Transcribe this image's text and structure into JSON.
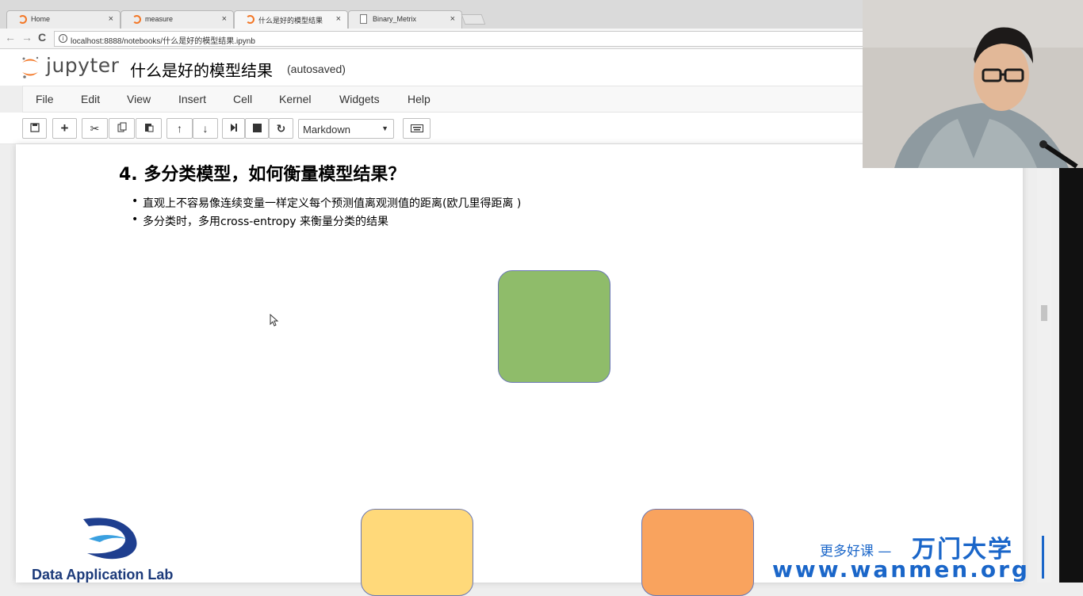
{
  "browser": {
    "tabs": [
      {
        "label": "Home",
        "icon": "jupyter-icon"
      },
      {
        "label": "measure",
        "icon": "jupyter-icon"
      },
      {
        "label": "什么是好的模型结果",
        "icon": "jupyter-icon",
        "active": true
      },
      {
        "label": "Binary_Metrix",
        "icon": "file-icon"
      }
    ],
    "close_glyph": "×",
    "url": "localhost:8888/notebooks/什么是好的模型结果.ipynb",
    "back_glyph": "←",
    "forward_glyph": "→",
    "reload_glyph": "C"
  },
  "jupyter": {
    "logo_text": "jupyter",
    "notebook_title": "什么是好的模型结果",
    "save_status": "(autosaved)",
    "menu": [
      "File",
      "Edit",
      "View",
      "Insert",
      "Cell",
      "Kernel",
      "Widgets",
      "Help"
    ],
    "toolbar": {
      "icons": [
        "save-icon",
        "add-cell-icon",
        "cut-icon",
        "copy-icon",
        "paste-icon",
        "move-up-icon",
        "move-down-icon",
        "run-icon",
        "stop-icon",
        "restart-icon",
        "keyboard-icon"
      ],
      "cell_type": "Markdown"
    }
  },
  "cell": {
    "heading": "4. 多分类模型，如何衡量模型结果？",
    "bullets": [
      "直观上不容易像连续变量一样定义每个预测值离观测值的距离(欧几里得距离 )",
      "多分类时，多用cross-entropy 来衡量分类的结果"
    ],
    "boxes": [
      {
        "color": "#8fbc6a"
      },
      {
        "color": "#ffd97a"
      },
      {
        "color": "#f9a35e"
      }
    ]
  },
  "watermark": {
    "lab_name": "Data Application Lab",
    "sub": "更多好课 —",
    "brand": "万门大学",
    "url": "www.wanmen.org"
  }
}
